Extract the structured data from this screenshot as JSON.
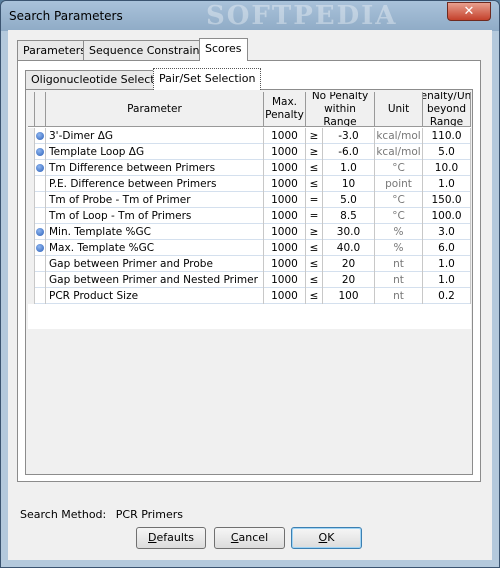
{
  "window": {
    "title": "Search Parameters",
    "watermark": "SOFTPEDIA",
    "close_glyph": "✕"
  },
  "tabs": [
    "Parameters",
    "Sequence Constraints",
    "Scores"
  ],
  "subtabs": [
    "Oligonucleotide Selection",
    "Pair/Set Selection"
  ],
  "table": {
    "headers": {
      "parameter": "Parameter",
      "max_penalty": "Max. Penalty",
      "range": "No Penalty within Range",
      "unit": "Unit",
      "penalty_unit": "Penalty/Unit beyond Range"
    },
    "rows": [
      {
        "bullet": true,
        "parameter": "3'-Dimer ΔG",
        "max": "1000",
        "op": "≥",
        "value": "-3.0",
        "unit": "kcal/mol",
        "penalty": "110.0"
      },
      {
        "bullet": true,
        "parameter": "Template Loop ΔG",
        "max": "1000",
        "op": "≥",
        "value": "-6.0",
        "unit": "kcal/mol",
        "penalty": "5.0"
      },
      {
        "bullet": true,
        "parameter": "Tm Difference between Primers",
        "max": "1000",
        "op": "≤",
        "value": "1.0",
        "unit": "°C",
        "penalty": "10.0"
      },
      {
        "bullet": false,
        "parameter": "P.E. Difference between Primers",
        "max": "1000",
        "op": "≤",
        "value": "10",
        "unit": "point",
        "penalty": "1.0"
      },
      {
        "bullet": false,
        "parameter": "Tm of Probe - Tm of Primer",
        "max": "1000",
        "op": "=",
        "value": "5.0",
        "unit": "°C",
        "penalty": "150.0"
      },
      {
        "bullet": false,
        "parameter": "Tm of Loop - Tm of Primers",
        "max": "1000",
        "op": "=",
        "value": "8.5",
        "unit": "°C",
        "penalty": "100.0"
      },
      {
        "bullet": true,
        "parameter": "Min. Template %GC",
        "max": "1000",
        "op": "≥",
        "value": "30.0",
        "unit": "%",
        "penalty": "3.0"
      },
      {
        "bullet": true,
        "parameter": "Max. Template %GC",
        "max": "1000",
        "op": "≤",
        "value": "40.0",
        "unit": "%",
        "penalty": "6.0"
      },
      {
        "bullet": false,
        "parameter": "Gap between Primer and Probe",
        "max": "1000",
        "op": "≤",
        "value": "20",
        "unit": "nt",
        "penalty": "1.0"
      },
      {
        "bullet": false,
        "parameter": "Gap between Primer and Nested Primer",
        "max": "1000",
        "op": "≤",
        "value": "20",
        "unit": "nt",
        "penalty": "1.0"
      },
      {
        "bullet": false,
        "parameter": "PCR Product Size",
        "max": "1000",
        "op": "≤",
        "value": "100",
        "unit": "nt",
        "penalty": "0.2"
      }
    ]
  },
  "status": {
    "label": "Search Method:",
    "value": "PCR Primers"
  },
  "buttons": {
    "defaults": "Defaults",
    "cancel": "Cancel",
    "ok": "OK"
  },
  "colors": {
    "accent": "#3c7fb1",
    "row_divider": "#d4e0ee",
    "bullet": "#2a5fb8"
  }
}
